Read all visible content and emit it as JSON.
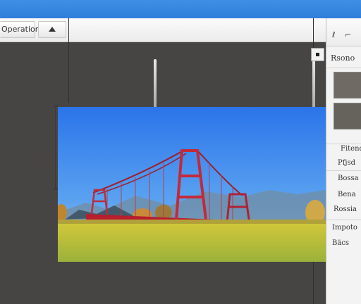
{
  "toolbar": {
    "menu_label": "Operation",
    "up_button": "triangle-up-icon"
  },
  "panel": {
    "tab_icons": [
      "brush-icon",
      "wand-icon"
    ],
    "header": "Rsono",
    "items": [
      "Fitend",
      "Pfjsd",
      "Bossa",
      "Bena",
      "Rossia",
      "Impoto",
      "Bäcs"
    ]
  },
  "colors": {
    "titlebar": "#2f7fda",
    "canvas": "#474543",
    "swatch_1": "#6f6a64",
    "swatch_2": "#66625c",
    "bridge": "#b81e2e"
  }
}
